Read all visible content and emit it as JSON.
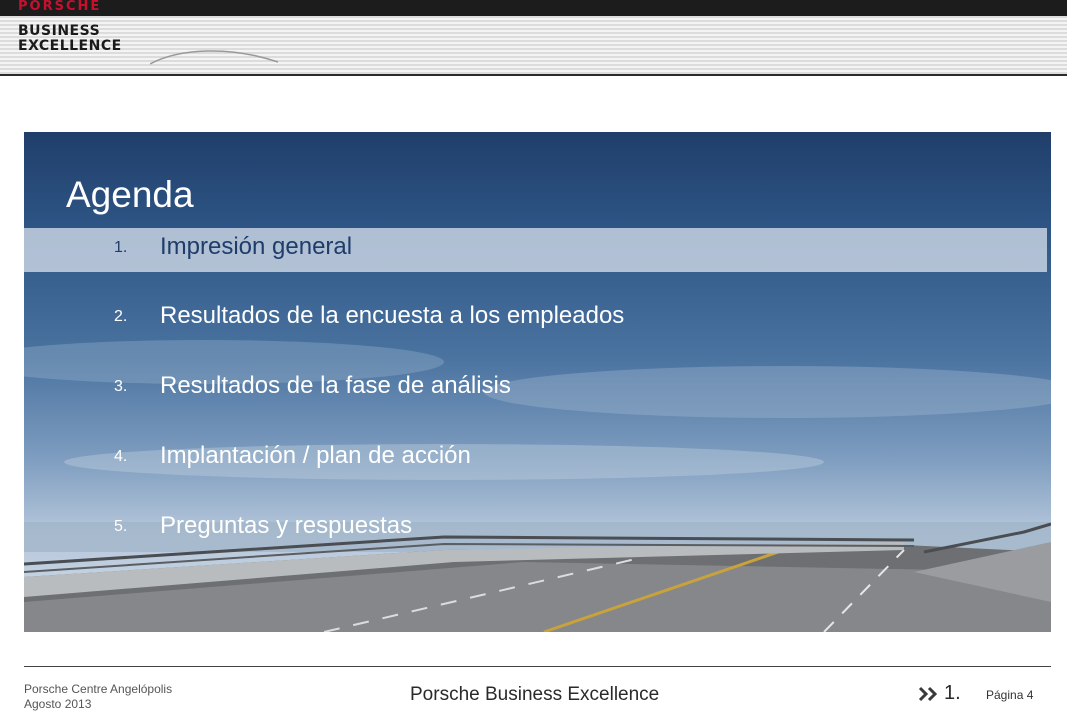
{
  "header": {
    "brand": "PORSCHE",
    "logo_line1": "BUSINESS",
    "logo_line2": "EXCELLENCE"
  },
  "slide": {
    "title": "Agenda",
    "items": [
      {
        "number": "1.",
        "label": "Impresión general",
        "active": true
      },
      {
        "number": "2.",
        "label": "Resultados de la encuesta a los empleados",
        "active": false
      },
      {
        "number": "3.",
        "label": "Resultados de la fase de análisis",
        "active": false
      },
      {
        "number": "4.",
        "label": "Implantación / plan de acción",
        "active": false
      },
      {
        "number": "5.",
        "label": "Preguntas y respuestas",
        "active": false
      }
    ]
  },
  "footer": {
    "company": "Porsche Centre  Angelópolis",
    "date": "Agosto 2013",
    "center_text": "Porsche Business Excellence",
    "section": "1.",
    "page": "Página 4"
  },
  "colors": {
    "active_text": "#1e3d6b",
    "highlight": "#cdd7e4",
    "brand_red": "#c8102e"
  }
}
